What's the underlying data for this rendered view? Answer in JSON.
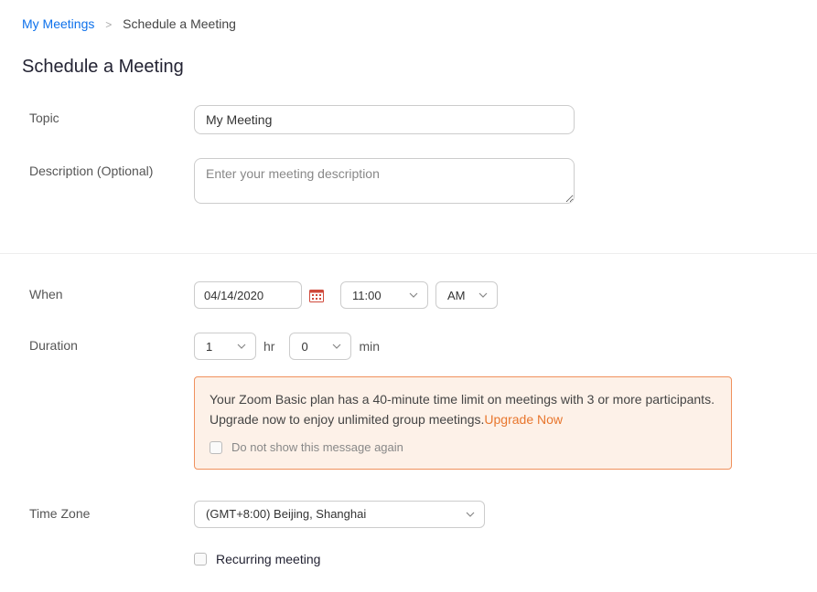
{
  "breadcrumb": {
    "link": "My Meetings",
    "current": "Schedule a Meeting"
  },
  "page_title": "Schedule a Meeting",
  "form": {
    "topic": {
      "label": "Topic",
      "value": "My Meeting"
    },
    "description": {
      "label": "Description (Optional)",
      "placeholder": "Enter your meeting description"
    },
    "when": {
      "label": "When",
      "date": "04/14/2020",
      "time": "11:00",
      "ampm": "AM"
    },
    "duration": {
      "label": "Duration",
      "hours": "1",
      "hr_label": "hr",
      "minutes": "0",
      "min_label": "min"
    },
    "timezone": {
      "label": "Time Zone",
      "value": "(GMT+8:00) Beijing, Shanghai"
    },
    "recurring": {
      "label": "Recurring meeting"
    }
  },
  "notice": {
    "text1": "Your Zoom Basic plan has a 40-minute time limit on meetings with 3 or more participants. Upgrade now to enjoy unlimited group meetings.",
    "link": "Upgrade Now",
    "checkbox_label": "Do not show this message again"
  }
}
